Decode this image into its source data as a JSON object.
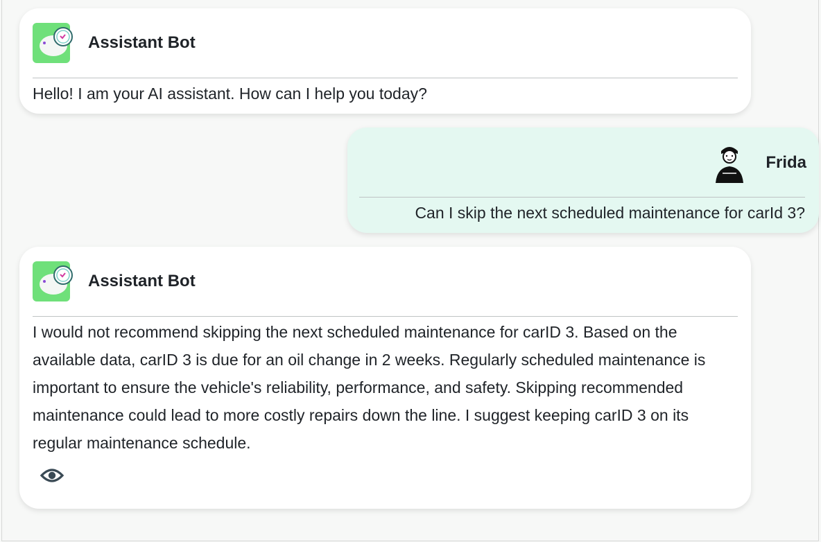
{
  "messages": [
    {
      "sender": "Assistant Bot",
      "avatar_icon": "robot-avatar-icon",
      "text": "Hello! I am your AI assistant. How can I help you today?"
    },
    {
      "sender": "Frida",
      "avatar_icon": "user-avatar-icon",
      "text": "Can I skip the next scheduled maintenance for carId 3?"
    },
    {
      "sender": "Assistant Bot",
      "avatar_icon": "robot-avatar-icon",
      "text": "I would not recommend skipping the next scheduled maintenance for carID 3. Based on the available data, carID 3 is due for an oil change in 2 weeks. Regularly scheduled maintenance is important to ensure the vehicle's reliability, performance, and safety. Skipping recommended maintenance could lead to more costly repairs down the line. I suggest keeping carID 3 on its regular maintenance schedule.",
      "action_icon": "eye-icon"
    }
  ],
  "colors": {
    "bot_bubble": "#ffffff",
    "user_bubble": "#e4f8f1",
    "bot_avatar_bg": "#6fe07a",
    "text": "#1f2328"
  }
}
